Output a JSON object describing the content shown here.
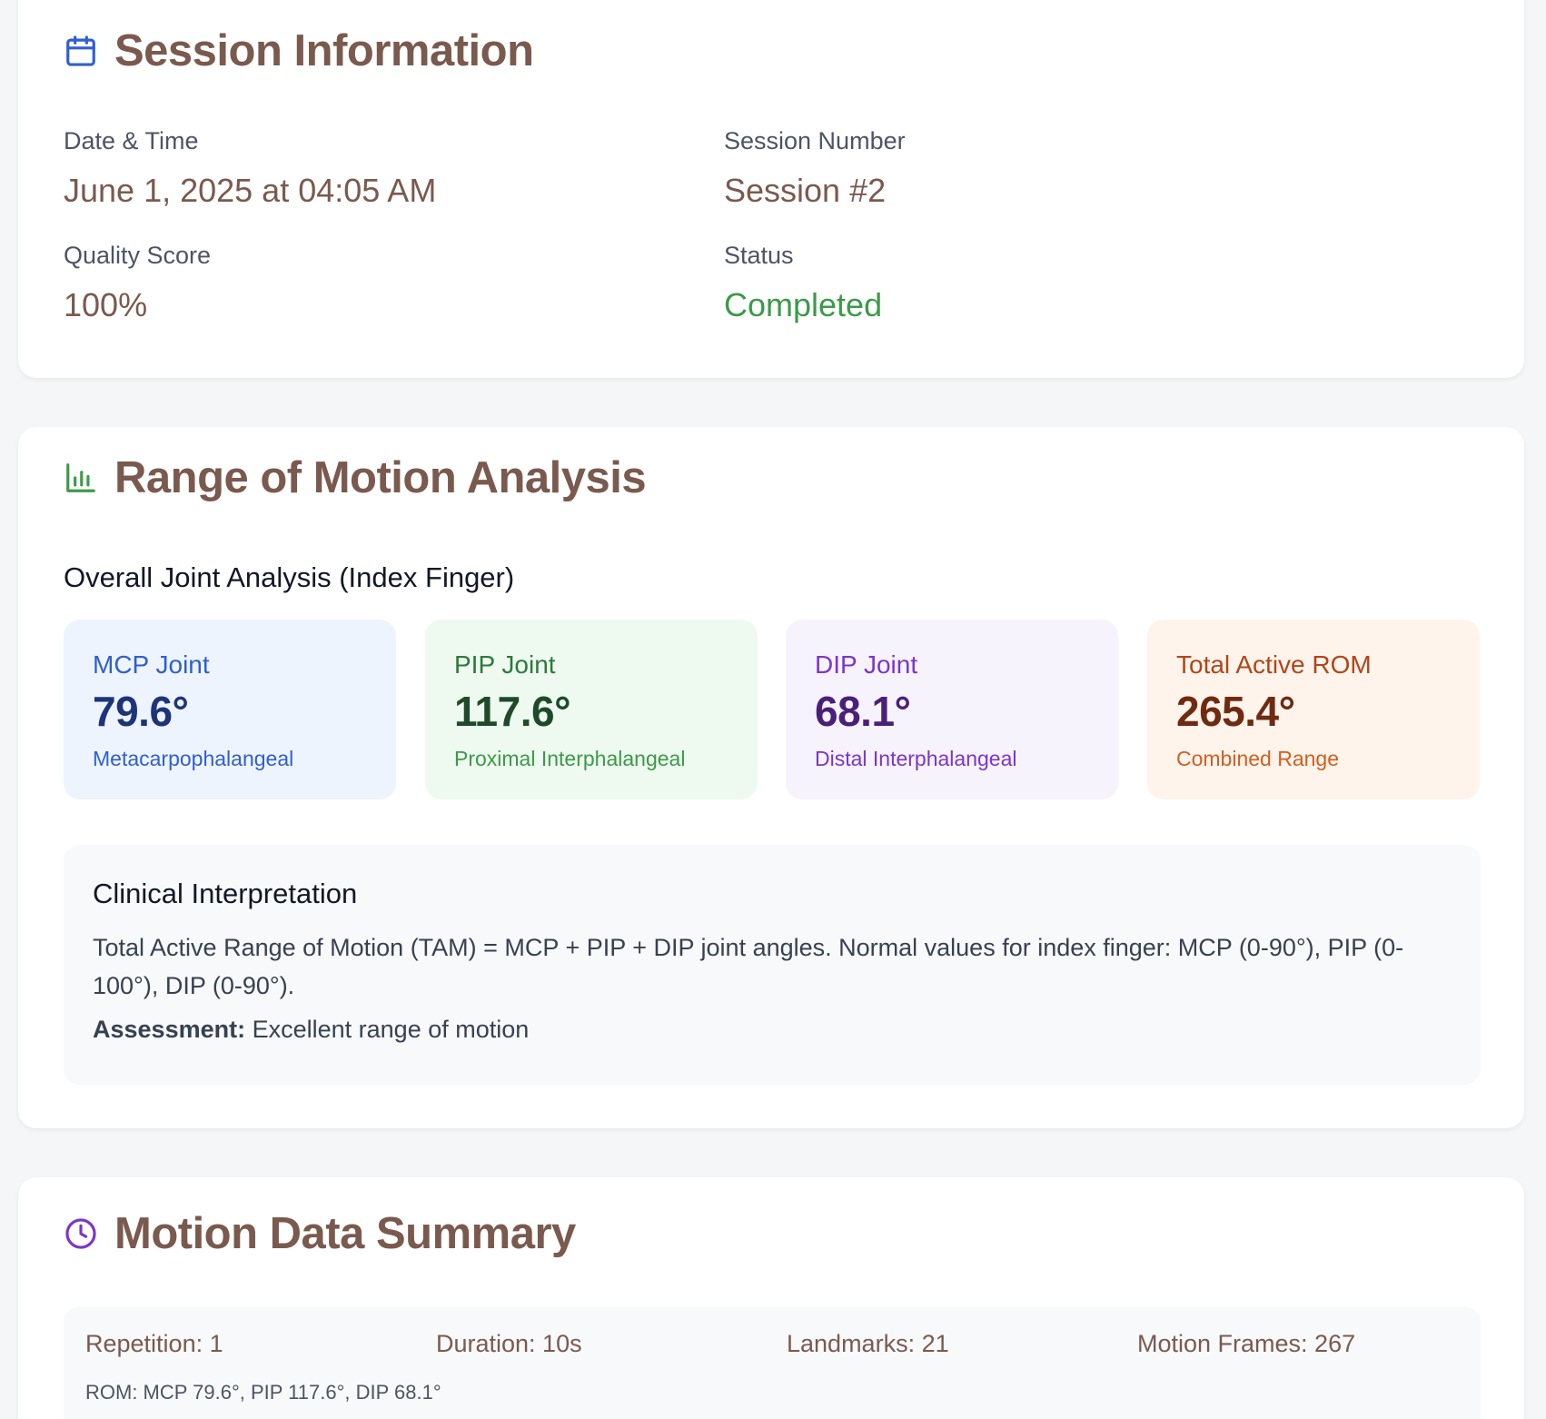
{
  "session": {
    "title": "Session Information",
    "icon": "calendar-icon",
    "date_label": "Date & Time",
    "date_value": "June 1, 2025 at 04:05 AM",
    "number_label": "Session Number",
    "number_value": "Session #2",
    "quality_label": "Quality Score",
    "quality_value": "100%",
    "status_label": "Status",
    "status_value": "Completed"
  },
  "rom": {
    "title": "Range of Motion Analysis",
    "icon": "bar-chart-icon",
    "subtitle": "Overall Joint Analysis (Index Finger)",
    "joints": [
      {
        "name": "MCP Joint",
        "value": "79.6°",
        "desc": "Metacarpophalangeal"
      },
      {
        "name": "PIP Joint",
        "value": "117.6°",
        "desc": "Proximal Interphalangeal"
      },
      {
        "name": "DIP Joint",
        "value": "68.1°",
        "desc": "Distal Interphalangeal"
      },
      {
        "name": "Total Active ROM",
        "value": "265.4°",
        "desc": "Combined Range"
      }
    ],
    "clinical_title": "Clinical Interpretation",
    "clinical_text": "Total Active Range of Motion (TAM) = MCP + PIP + DIP joint angles. Normal values for index finger: MCP (0-90°), PIP (0-100°), DIP (0-90°).",
    "assessment_label": "Assessment:",
    "assessment_value": "Excellent range of motion"
  },
  "motion": {
    "title": "Motion Data Summary",
    "icon": "clock-icon",
    "repetition": "Repetition: 1",
    "duration": "Duration: 10s",
    "landmarks": "Landmarks: 21",
    "frames": "Motion Frames: 267",
    "rom_line": "ROM: MCP 79.6°, PIP 117.6°, DIP 68.1°"
  },
  "colors": {
    "heading": "#7a5a4e",
    "status_green": "#3c9a49",
    "calendar_icon": "#2f5fcf",
    "chart_icon": "#3c9a49",
    "clock_icon": "#7c35c9"
  }
}
